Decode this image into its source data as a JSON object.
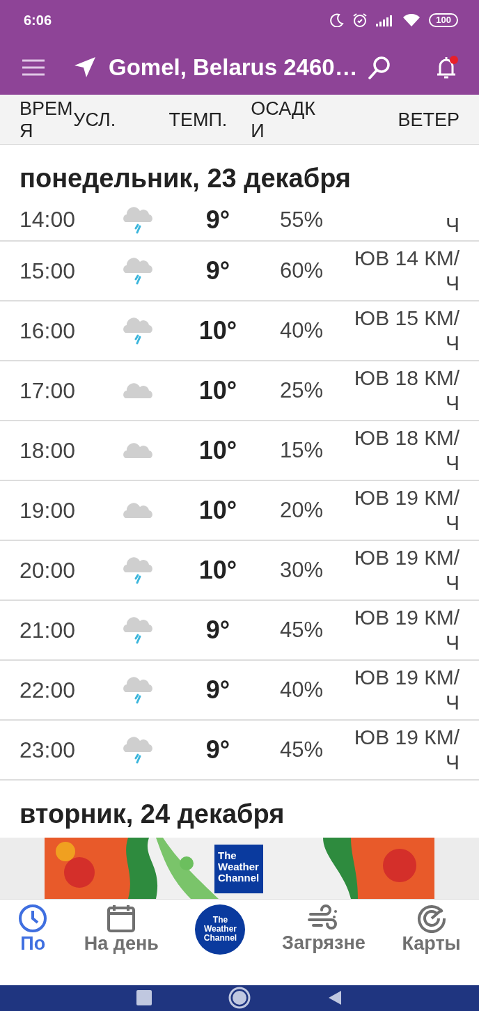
{
  "status_bar": {
    "time": "6:06",
    "battery": "100"
  },
  "app_bar": {
    "location": "Gomel, Belarus 2460…",
    "notification": true
  },
  "columns": [
    "ВРЕМЯ",
    "УСЛ.",
    "ТЕМП.",
    "ОСАДКИ",
    "ВЕТЕР"
  ],
  "days": [
    {
      "title": "понедельник, 23 декабря",
      "rows": [
        {
          "time": "14:00",
          "kind": "rain",
          "temp": "9°",
          "precip": "55%",
          "wind": "Ч",
          "clipped": true
        },
        {
          "time": "15:00",
          "kind": "rain",
          "temp": "9°",
          "precip": "60%",
          "wind": "ЮВ 14 КМ/Ч",
          "clipped": false
        },
        {
          "time": "16:00",
          "kind": "rain",
          "temp": "10°",
          "precip": "40%",
          "wind": "ЮВ 15 КМ/Ч",
          "clipped": false
        },
        {
          "time": "17:00",
          "kind": "cloudy",
          "temp": "10°",
          "precip": "25%",
          "wind": "ЮВ 18 КМ/Ч",
          "clipped": false
        },
        {
          "time": "18:00",
          "kind": "cloudy",
          "temp": "10°",
          "precip": "15%",
          "wind": "ЮВ 18 КМ/Ч",
          "clipped": false
        },
        {
          "time": "19:00",
          "kind": "cloudy",
          "temp": "10°",
          "precip": "20%",
          "wind": "ЮВ 19 КМ/Ч",
          "clipped": false
        },
        {
          "time": "20:00",
          "kind": "rain",
          "temp": "10°",
          "precip": "30%",
          "wind": "ЮВ 19 КМ/Ч",
          "clipped": false
        },
        {
          "time": "21:00",
          "kind": "rain",
          "temp": "9°",
          "precip": "45%",
          "wind": "ЮВ 19 КМ/Ч",
          "clipped": false
        },
        {
          "time": "22:00",
          "kind": "rain",
          "temp": "9°",
          "precip": "40%",
          "wind": "ЮВ 19 КМ/Ч",
          "clipped": false
        },
        {
          "time": "23:00",
          "kind": "rain",
          "temp": "9°",
          "precip": "45%",
          "wind": "ЮВ 19 КМ/Ч",
          "clipped": false
        }
      ]
    },
    {
      "title": "вторник, 24 декабря"
    }
  ],
  "ad": {
    "logo": "The Weather Channel"
  },
  "bottom_nav": [
    {
      "kind": "clock",
      "label": "По",
      "selected": true
    },
    {
      "kind": "calendar",
      "label": "На день",
      "selected": false
    },
    {
      "kind": "logo",
      "label": "The Weather Channel",
      "selected": false
    },
    {
      "kind": "wind",
      "label": "Загрязне",
      "selected": false
    },
    {
      "kind": "radar",
      "label": "Карты",
      "selected": false
    }
  ]
}
